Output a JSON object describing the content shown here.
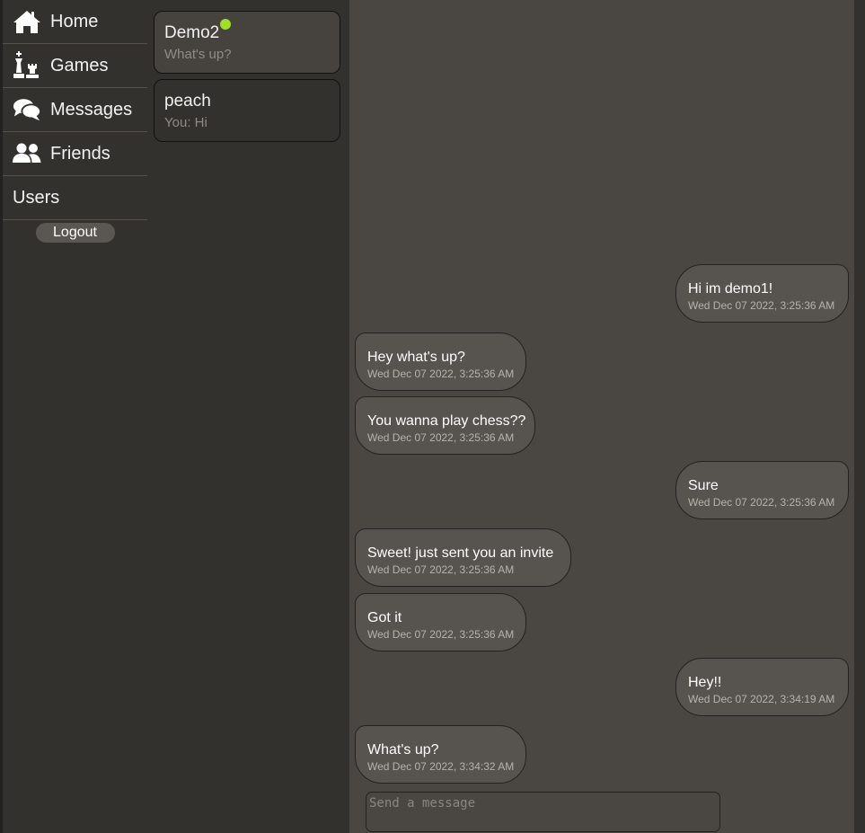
{
  "nav": {
    "items": [
      {
        "label": "Home",
        "icon": "home-icon"
      },
      {
        "label": "Games",
        "icon": "chess-icon"
      },
      {
        "label": "Messages",
        "icon": "chat-icon"
      },
      {
        "label": "Friends",
        "icon": "users-icon"
      },
      {
        "label": "Users",
        "icon": ""
      }
    ],
    "logout_label": "Logout"
  },
  "conversations": [
    {
      "name": "Demo2",
      "preview": "What's up?",
      "online": true,
      "active": true
    },
    {
      "name": "peach",
      "preview": "You: Hi",
      "online": false,
      "active": false
    }
  ],
  "messages": [
    {
      "text": "Hi im demo1!",
      "time": "Wed Dec 07 2022, 3:25:36 AM",
      "direction": "out"
    },
    {
      "text": "Hey what's up?",
      "time": "Wed Dec 07 2022, 3:25:36 AM",
      "direction": "in"
    },
    {
      "text": "You wanna play chess??",
      "time": "Wed Dec 07 2022, 3:25:36 AM",
      "direction": "in"
    },
    {
      "text": "Sure",
      "time": "Wed Dec 07 2022, 3:25:36 AM",
      "direction": "out"
    },
    {
      "text": "Sweet! just sent you an invite",
      "time": "Wed Dec 07 2022, 3:25:36 AM",
      "direction": "in"
    },
    {
      "text": "Got it",
      "time": "Wed Dec 07 2022, 3:25:36 AM",
      "direction": "in"
    },
    {
      "text": "Hey!!",
      "time": "Wed Dec 07 2022, 3:34:19 AM",
      "direction": "out"
    },
    {
      "text": "What's up?",
      "time": "Wed Dec 07 2022, 3:34:32 AM",
      "direction": "in"
    }
  ],
  "composer": {
    "placeholder": "Send a message"
  },
  "colors": {
    "online": "#9de024",
    "bubble": "#57534f",
    "chat_bg": "#4a4743",
    "sidebar_bg": "#33312d"
  }
}
